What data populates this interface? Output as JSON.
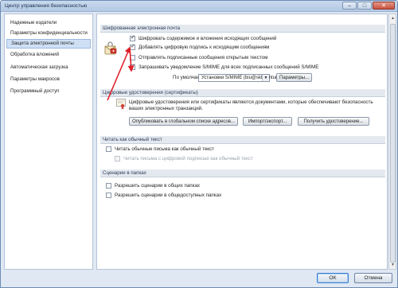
{
  "window": {
    "title": "Центр управления безопасностью",
    "controls": [
      "–",
      "□",
      "✕"
    ]
  },
  "sidebar": {
    "items": [
      {
        "label": "Надежные издатели"
      },
      {
        "label": "Параметры конфиденциальности"
      },
      {
        "label": "Защита электронной почты",
        "selected": true
      },
      {
        "label": "Обработка вложений"
      },
      {
        "label": "Автоматическая загрузка"
      },
      {
        "label": "Параметры макросов"
      },
      {
        "label": "Программный доступ"
      }
    ]
  },
  "encrypted_mail": {
    "header": "Шифрованная электронная почта",
    "options": [
      {
        "label": "Шифровать содержимое и вложения исходящих сообщений",
        "checked": true
      },
      {
        "label": "Добавлять цифровую подпись к исходящим сообщениям",
        "checked": true
      },
      {
        "label": "Отправлять подписанные сообщения открытым текстом",
        "checked": false
      },
      {
        "label": "Запрашивать уведомление S/MIME для всех подписанных сообщений S/MIME",
        "checked": true
      }
    ],
    "default_label": "По умолчанию:",
    "default_value": "Установки S/MIME (biu@skbkontur.ru)",
    "settings_button": "Параметры..."
  },
  "digital_ids": {
    "header": "Цифровые удостоверения (сертификаты)",
    "description_line1": "Цифровые удостоверения или сертификаты являются документами, которые обеспечивают безопасность",
    "description_line2": "ваших электронных транзакций.",
    "publish_button": "Опубликовать в глобальном списке адресов...",
    "import_export_button": "Импорт/экспорт...",
    "get_id_button": "Получить удостоверение..."
  },
  "plain_text": {
    "header": "Читать как обычный текст",
    "options": [
      {
        "label": "Читать обычные письма как обычный текст",
        "checked": false,
        "disabled": false
      },
      {
        "label": "Читать письма с цифровой подписью как обычный текст",
        "checked": false,
        "disabled": true
      }
    ]
  },
  "scripts": {
    "header": "Сценарии в папках",
    "options": [
      {
        "label": "Разрешить сценарии в общих папках",
        "checked": false
      },
      {
        "label": "Разрешить сценарии в общедоступных папках",
        "checked": false
      }
    ]
  },
  "footer": {
    "ok_label": "OK",
    "cancel_label": "Отмена"
  },
  "colors": {
    "annotation_arrow": "#e0202a",
    "selected_nav": "#cfe0f5",
    "title_bar": "#b3c9e4"
  },
  "icons": {
    "encrypted_mail": "padlock-envelope-icon",
    "digital_ids": "certificate-icon",
    "scroll_up": "chevron-up-icon",
    "scroll_down": "chevron-down-icon"
  }
}
